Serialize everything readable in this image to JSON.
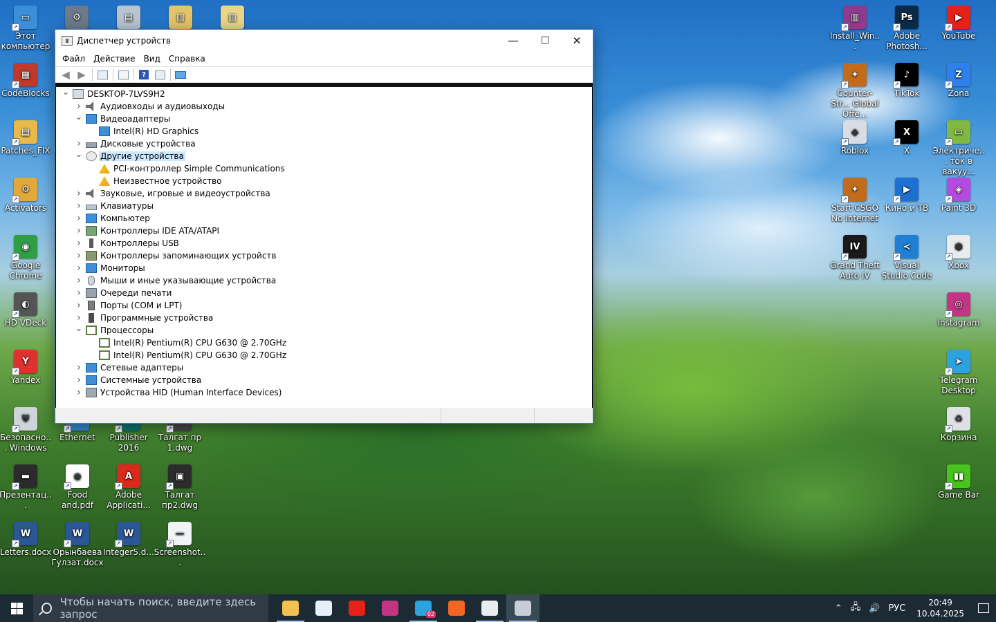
{
  "desktop": {
    "left_icons": [
      {
        "label": "Этот компьютер",
        "color": "#3b8fd9",
        "glyph": "▭"
      },
      {
        "label": "CodeBlocks",
        "color": "#c0392b",
        "glyph": "▦"
      },
      {
        "label": "Patches_FIX",
        "color": "#e9b94a",
        "glyph": "▤"
      },
      {
        "label": "Activators",
        "color": "#e2a93a",
        "glyph": "⚙"
      },
      {
        "label": "Google Chrome",
        "color": "#2f9e44",
        "glyph": "◉"
      },
      {
        "label": "HD VDeck",
        "color": "#555555",
        "glyph": "◐"
      },
      {
        "label": "Yandex",
        "color": "#e03131",
        "glyph": "Y"
      },
      {
        "label": "Безопасно... Windows",
        "color": "#cfd4da",
        "glyph": "⛨"
      },
      {
        "label": "Презентац...",
        "color": "#2b2b2b",
        "glyph": "▬"
      },
      {
        "label": "Letters.docx",
        "color": "#2b5797",
        "glyph": "W"
      }
    ],
    "col2_icons": [
      {
        "label": "Ethernet",
        "color": "#3b8fd9",
        "glyph": ""
      },
      {
        "label": "Food and.pdf",
        "color": "#ffffff",
        "glyph": "◉"
      },
      {
        "label": "Орынбаева Гулзат.docx",
        "color": "#2b5797",
        "glyph": "W"
      }
    ],
    "col3_icons": [
      {
        "label": "Publisher 2016",
        "color": "#0b7a75",
        "glyph": ""
      },
      {
        "label": "Adobe Applicati...",
        "color": "#d9291c",
        "glyph": "A"
      },
      {
        "label": "Integer5.d...",
        "color": "#2b5797",
        "glyph": "W"
      }
    ],
    "col4_icons": [
      {
        "label": "Талгат пр 1.dwg",
        "color": "#4a4a4a",
        "glyph": ""
      },
      {
        "label": "Талгат пр2.dwg",
        "color": "#2b2b2b",
        "glyph": "▣"
      },
      {
        "label": "Screenshot...",
        "color": "#f1f3f5",
        "glyph": "—"
      }
    ],
    "right_col1": [
      {
        "label": "Install_Win...",
        "color": "#8e3b8e",
        "glyph": "▥"
      },
      {
        "label": "Counter-Str... Global Offe...",
        "color": "#c26b1a",
        "glyph": "✦"
      },
      {
        "label": "Roblox",
        "color": "#d7dde3",
        "glyph": "◆"
      },
      {
        "label": "Start CSGO No Internet",
        "color": "#c26b1a",
        "glyph": "✦"
      },
      {
        "label": "Grand Theft Auto IV",
        "color": "#1a1a1a",
        "glyph": "IV"
      }
    ],
    "right_col2": [
      {
        "label": "Adobe Photosh...",
        "color": "#0a2a4a",
        "glyph": "Ps"
      },
      {
        "label": "TikTok",
        "color": "#000000",
        "glyph": "♪"
      },
      {
        "label": "X",
        "color": "#000000",
        "glyph": "X"
      },
      {
        "label": "Кино и ТВ",
        "color": "#1d6fd1",
        "glyph": "▶"
      },
      {
        "label": "Visual Studio Code",
        "color": "#1e7fd4",
        "glyph": "≺"
      }
    ],
    "right_col3": [
      {
        "label": "YouTube",
        "color": "#e62117",
        "glyph": "▶"
      },
      {
        "label": "Zona",
        "color": "#2f80ed",
        "glyph": "Z"
      },
      {
        "label": "Электриче... ток в вакуу...",
        "color": "#7fb843",
        "glyph": "▭"
      },
      {
        "label": "Paint 3D",
        "color": "#b44be1",
        "glyph": "◈"
      },
      {
        "label": "Xbox",
        "color": "#e9ecef",
        "glyph": "⬢"
      },
      {
        "label": "Instagram",
        "color": "#c13584",
        "glyph": "◎"
      },
      {
        "label": "Telegram Desktop",
        "color": "#2aa3e0",
        "glyph": "➤"
      },
      {
        "label": "Корзина",
        "color": "#dee2e6",
        "glyph": "♻"
      },
      {
        "label": "Game Bar",
        "color": "#47c41d",
        "glyph": "▮▮"
      }
    ],
    "top_icons": [
      {
        "label": "",
        "color": "#6c7a89",
        "glyph": "⚙"
      },
      {
        "label": "",
        "color": "#b8c4d0",
        "glyph": "▤"
      },
      {
        "label": "",
        "color": "#e2c46a",
        "glyph": "▥"
      },
      {
        "label": "",
        "color": "#e9d58a",
        "glyph": "▥"
      }
    ]
  },
  "window": {
    "title": "Диспетчер устройств",
    "menu": [
      "Файл",
      "Действие",
      "Вид",
      "Справка"
    ],
    "minimize": "—",
    "maximize": "☐",
    "close": "✕",
    "tree": {
      "root": "DESKTOP-7LVS9H2",
      "items": [
        {
          "label": "Аудиовходы и аудиовыходы",
          "expanded": false,
          "icon": "audio",
          "children": []
        },
        {
          "label": "Видеоадаптеры",
          "expanded": true,
          "icon": "display",
          "children": [
            "Intel(R) HD Graphics"
          ]
        },
        {
          "label": "Дисковые устройства",
          "expanded": false,
          "icon": "disk",
          "children": []
        },
        {
          "label": "Другие устройства",
          "expanded": true,
          "selected": true,
          "icon": "other",
          "children": [
            "PCI-контроллер Simple Communications",
            "Неизвестное устройство"
          ]
        },
        {
          "label": "Звуковые, игровые и видеоустройства",
          "expanded": false,
          "icon": "audio",
          "children": []
        },
        {
          "label": "Клавиатуры",
          "expanded": false,
          "icon": "keyboard",
          "children": []
        },
        {
          "label": "Компьютер",
          "expanded": false,
          "icon": "computer",
          "children": []
        },
        {
          "label": "Контроллеры IDE ATA/ATAPI",
          "expanded": false,
          "icon": "ide",
          "children": []
        },
        {
          "label": "Контроллеры USB",
          "expanded": false,
          "icon": "usb",
          "children": []
        },
        {
          "label": "Контроллеры запоминающих устройств",
          "expanded": false,
          "icon": "storage",
          "children": []
        },
        {
          "label": "Мониторы",
          "expanded": false,
          "icon": "display",
          "children": []
        },
        {
          "label": "Мыши и иные указывающие устройства",
          "expanded": false,
          "icon": "mouse",
          "children": []
        },
        {
          "label": "Очереди печати",
          "expanded": false,
          "icon": "printer",
          "children": []
        },
        {
          "label": "Порты (COM и LPT)",
          "expanded": false,
          "icon": "port",
          "children": []
        },
        {
          "label": "Программные устройства",
          "expanded": false,
          "icon": "software",
          "children": []
        },
        {
          "label": "Процессоры",
          "expanded": true,
          "icon": "cpu",
          "children": [
            "Intel(R) Pentium(R) CPU G630 @ 2.70GHz",
            "Intel(R) Pentium(R) CPU G630 @ 2.70GHz"
          ]
        },
        {
          "label": "Сетевые адаптеры",
          "expanded": false,
          "icon": "network",
          "children": []
        },
        {
          "label": "Системные устройства",
          "expanded": false,
          "icon": "system",
          "children": []
        },
        {
          "label": "Устройства HID (Human Interface Devices)",
          "expanded": false,
          "icon": "hid",
          "children": []
        }
      ]
    }
  },
  "taskbar": {
    "search_placeholder": "Чтобы начать поиск, введите здесь запрос",
    "apps": [
      {
        "name": "file-explorer",
        "color": "#f2c14e",
        "open": true,
        "active": false
      },
      {
        "name": "microsoft-store",
        "color": "#e6f0fa",
        "open": false,
        "active": false
      },
      {
        "name": "youtube",
        "color": "#e62117",
        "open": false,
        "active": false
      },
      {
        "name": "instagram",
        "color": "#c13584",
        "open": false,
        "active": false
      },
      {
        "name": "telegram",
        "color": "#2aa3e0",
        "open": true,
        "active": false
      },
      {
        "name": "brave",
        "color": "#f26522",
        "open": false,
        "active": false
      },
      {
        "name": "settings",
        "color": "#e9ecef",
        "open": true,
        "active": false
      },
      {
        "name": "device-manager",
        "color": "#c7ced6",
        "open": true,
        "active": true
      }
    ],
    "telegram_badge": "02",
    "language": "РУС",
    "time": "20:49",
    "date": "10.04.2025"
  }
}
